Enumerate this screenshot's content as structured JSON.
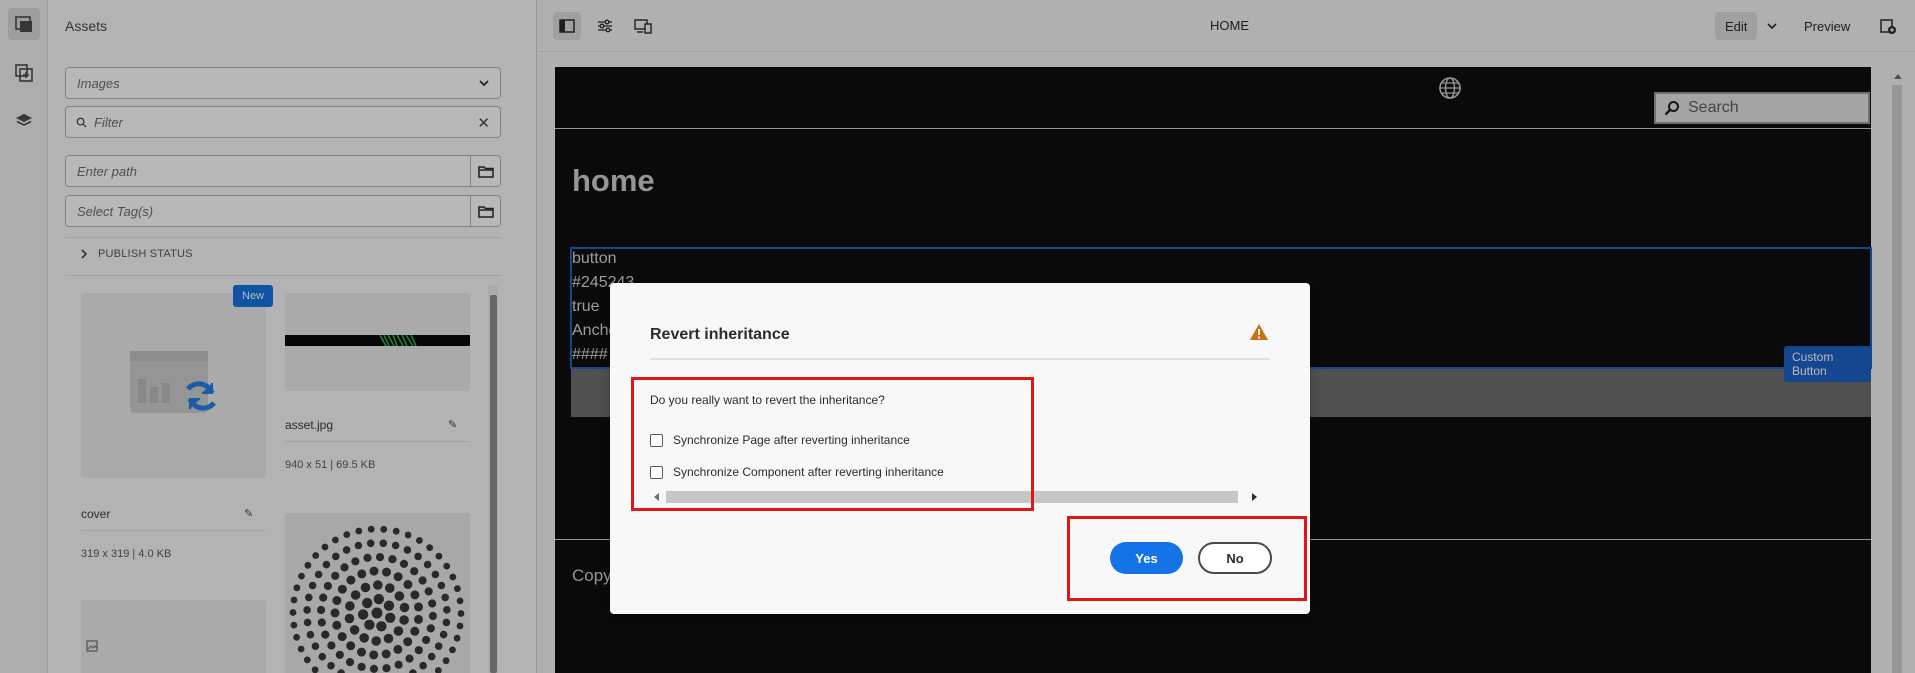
{
  "rail": {
    "items": [
      {
        "icon": "assets-icon",
        "active": true
      },
      {
        "icon": "components-icon",
        "active": false
      },
      {
        "icon": "layers-icon",
        "active": false
      }
    ]
  },
  "assets": {
    "title": "Assets",
    "type_select": "Images",
    "filter_placeholder": "Filter",
    "path_placeholder": "Enter path",
    "tags_placeholder": "Select Tag(s)",
    "publish_status": "PUBLISH STATUS",
    "cards": [
      {
        "name": "cover",
        "meta": "319 x 319 | 4.0 KB",
        "badge": "New"
      },
      {
        "name": "asset.jpg",
        "meta": "940 x 51 | 69.5 KB"
      }
    ]
  },
  "toolbar": {
    "page_title": "HOME",
    "edit_label": "Edit",
    "preview_label": "Preview"
  },
  "site": {
    "search_placeholder": "Search",
    "heading": "home",
    "component_lines": [
      "button",
      "#245243",
      "true",
      "Anchor",
      "####"
    ],
    "component_tag": "Custom Button",
    "footer_text": "Copy"
  },
  "dialog": {
    "title": "Revert inheritance",
    "question": "Do you really want to revert the inheritance?",
    "options": [
      "Synchronize Page after reverting inheritance",
      "Synchronize Component after reverting inheritance"
    ],
    "yes_label": "Yes",
    "no_label": "No"
  },
  "colors": {
    "accent": "#1473e6",
    "warning": "#cb6f10",
    "annotation": "#e01515",
    "component_outline": "#1e63c9"
  }
}
